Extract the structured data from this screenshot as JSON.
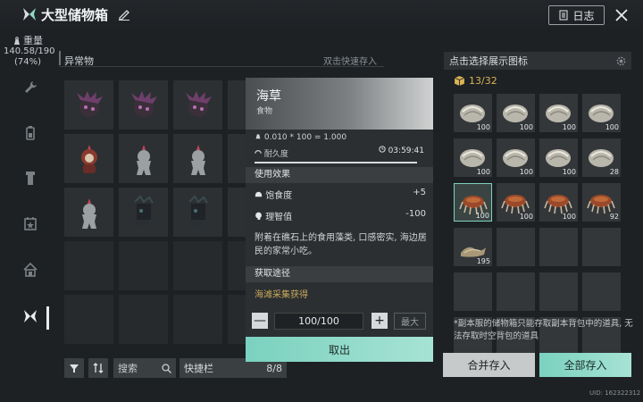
{
  "header": {
    "title": "大型储物箱",
    "log_label": "日志"
  },
  "weight": {
    "label": "重量",
    "value": "140.58/190",
    "percent": "(74%)"
  },
  "section": {
    "title": "异常物",
    "hint": "双击快速存入"
  },
  "bottom": {
    "search_label": "搜索",
    "quickbar_label": "快捷栏",
    "quickbar_count": "8/8"
  },
  "popup": {
    "name": "海草",
    "type": "食物",
    "weight_formula": "0.010 * 100 = 1.000",
    "durability_label": "耐久度",
    "durability_time": "03:59:41",
    "durability_level": 0.95,
    "effects_title": "使用效果",
    "effects": [
      {
        "label": "饱食度",
        "value": "+5"
      },
      {
        "label": "理智值",
        "value": "-100"
      }
    ],
    "description": "附着在礁石上的食用藻类, 口感密实, 海边居民的家常小吃。",
    "source_title": "获取途径",
    "source": "海滩采集获得",
    "quantity": "100/100",
    "minus": "—",
    "plus": "+",
    "max_label": "最大",
    "cancel_label": "取出"
  },
  "right_panel": {
    "header": "点击选择展示图标",
    "count": "13/32",
    "items": [
      {
        "kind": "shell",
        "count": "100"
      },
      {
        "kind": "shell",
        "count": "100"
      },
      {
        "kind": "shell",
        "count": "100"
      },
      {
        "kind": "shell",
        "count": "100"
      },
      {
        "kind": "shell",
        "count": "100"
      },
      {
        "kind": "shell",
        "count": "100"
      },
      {
        "kind": "shell",
        "count": "100"
      },
      {
        "kind": "shell",
        "count": "28"
      },
      {
        "kind": "crab",
        "count": "100"
      },
      {
        "kind": "crab",
        "count": "100"
      },
      {
        "kind": "crab",
        "count": "100"
      },
      {
        "kind": "crab",
        "count": "92"
      },
      {
        "kind": "seaweed",
        "count": "195"
      }
    ],
    "note": "*副本服的储物箱只能存取副本背包中的道具, 无法存取时空背包的道具",
    "merge_label": "合并存入",
    "store_all_label": "全部存入"
  },
  "uid": "UID: 162322312",
  "colors": {
    "accent": "#7ad1bf",
    "gold": "#d9b355",
    "source_text": "#c9a85c"
  }
}
